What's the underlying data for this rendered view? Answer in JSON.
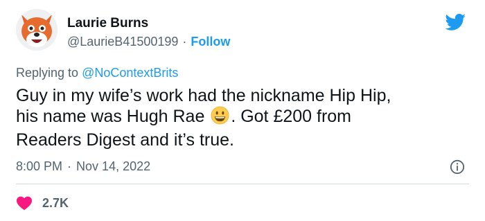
{
  "user": {
    "name": "Laurie Burns",
    "handle": "@LaurieB41500199",
    "separator": "·",
    "follow_label": "Follow",
    "avatar_icon": "fox-avatar-icon"
  },
  "reply": {
    "prefix": "Replying to ",
    "mention": "@NoContextBrits"
  },
  "tweet": {
    "text_part1": "Guy in my wife’s work had the nickname Hip Hip,\nhis name was Hugh Rae ",
    "emoji_icon": "grinning-face-emoji",
    "text_part2": ". Got £200 from\nReaders Digest and it’s true."
  },
  "meta": {
    "time": "8:00 PM",
    "separator": "·",
    "date": "Nov 14, 2022",
    "info_icon": "info-icon"
  },
  "stats": {
    "likes": "2.7K",
    "like_icon": "heart-icon"
  },
  "colors": {
    "brand": "#1d9bf0",
    "like": "#f91880",
    "text": "#0f1419",
    "muted": "#536471"
  }
}
